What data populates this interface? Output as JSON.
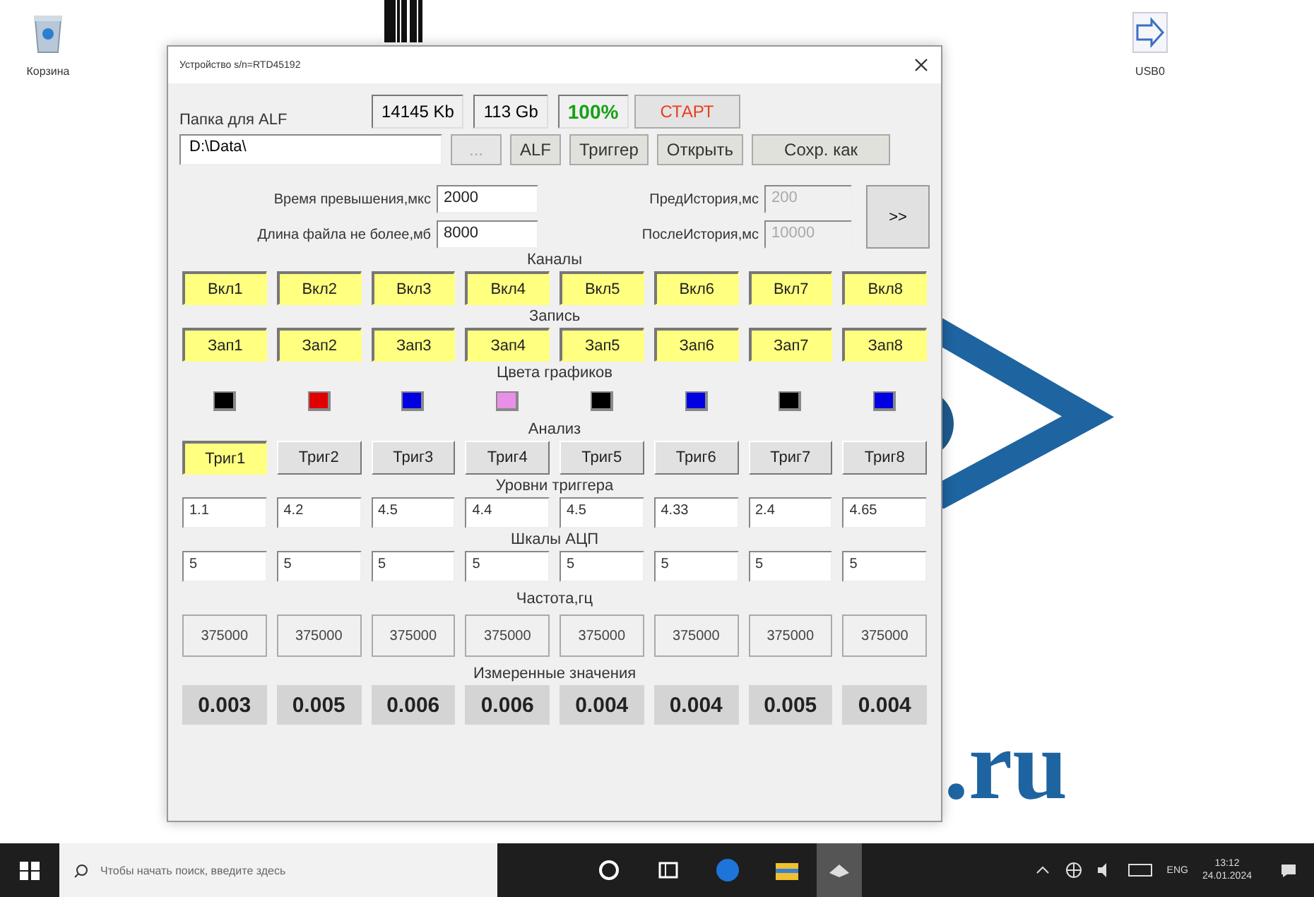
{
  "desktop": {
    "icons": [
      {
        "label": "Корзина",
        "kind": "recycle"
      },
      {
        "label": "USB0",
        "kind": "device"
      }
    ],
    "wallpaper_text": ".ru"
  },
  "window": {
    "title": "Устройство s/n=RTD45192",
    "stats": [
      {
        "text": "14145 Kb",
        "color": "#000000"
      },
      {
        "text": "113 Gb",
        "color": "#000000"
      },
      {
        "text": "100%",
        "color": "#16a016"
      }
    ],
    "start_button": "СТАРТ",
    "folder_label": "Папка для ALF",
    "folder_value": "D:\\Data\\",
    "buttons": [
      {
        "label": "...",
        "disabled": true
      },
      {
        "label": "ALF",
        "disabled": false
      },
      {
        "label": "Триггер",
        "disabled": false
      },
      {
        "label": "Открыть",
        "disabled": false
      },
      {
        "label": "Сохр. как",
        "disabled": false
      }
    ],
    "params": [
      {
        "label": "Время превышения,мкс",
        "value": "2000",
        "disabled": false
      },
      {
        "label": "ПредИстория,мс",
        "value": "200",
        "disabled": true
      },
      {
        "label": "Длина файла не более,мб",
        "value": "8000",
        "disabled": false
      },
      {
        "label": "ПослеИстория,мс",
        "value": "10000",
        "disabled": true
      }
    ],
    "more_button": ">>",
    "sections": [
      {
        "title": "Каналы",
        "kind": "toggles",
        "items": [
          {
            "label": "Вкл1",
            "checked": true
          },
          {
            "label": "Вкл2",
            "checked": true
          },
          {
            "label": "Вкл3",
            "checked": true
          },
          {
            "label": "Вкл4",
            "checked": true
          },
          {
            "label": "Вкл5",
            "checked": true
          },
          {
            "label": "Вкл6",
            "checked": true
          },
          {
            "label": "Вкл7",
            "checked": true
          },
          {
            "label": "Вкл8",
            "checked": true
          }
        ]
      },
      {
        "title": "Запись",
        "kind": "toggles",
        "items": [
          {
            "label": "Зап1",
            "checked": true
          },
          {
            "label": "Зап2",
            "checked": true
          },
          {
            "label": "Зап3",
            "checked": true
          },
          {
            "label": "Зап4",
            "checked": true
          },
          {
            "label": "Зап5",
            "checked": true
          },
          {
            "label": "Зап6",
            "checked": true
          },
          {
            "label": "Зап7",
            "checked": true
          },
          {
            "label": "Зап8",
            "checked": true
          }
        ]
      },
      {
        "title": "Цвета графиков",
        "kind": "colors",
        "items": [
          {
            "color": "#000000"
          },
          {
            "color": "#e00000"
          },
          {
            "color": "#0000e0"
          },
          {
            "color": "#e890e8"
          },
          {
            "color": "#000000"
          },
          {
            "color": "#0000e0"
          },
          {
            "color": "#000000"
          },
          {
            "color": "#0000e0"
          }
        ]
      },
      {
        "title": "Анализ",
        "kind": "toggles",
        "items": [
          {
            "label": "Триг1",
            "checked": true
          },
          {
            "label": "Триг2",
            "checked": false
          },
          {
            "label": "Триг3",
            "checked": false
          },
          {
            "label": "Триг4",
            "checked": false
          },
          {
            "label": "Триг5",
            "checked": false
          },
          {
            "label": "Триг6",
            "checked": false
          },
          {
            "label": "Триг7",
            "checked": false
          },
          {
            "label": "Триг8",
            "checked": false
          }
        ]
      },
      {
        "title": "Уровни триггера",
        "kind": "inputs",
        "items": [
          {
            "value": "1.1"
          },
          {
            "value": "4.2"
          },
          {
            "value": "4.5"
          },
          {
            "value": "4.4"
          },
          {
            "value": "4.5"
          },
          {
            "value": "4.33"
          },
          {
            "value": "2.4"
          },
          {
            "value": "4.65"
          }
        ]
      },
      {
        "title": "Шкалы АЦП",
        "kind": "inputs",
        "items": [
          {
            "value": "5"
          },
          {
            "value": "5"
          },
          {
            "value": "5"
          },
          {
            "value": "5"
          },
          {
            "value": "5"
          },
          {
            "value": "5"
          },
          {
            "value": "5"
          },
          {
            "value": "5"
          }
        ]
      },
      {
        "title": "Частота,гц",
        "kind": "cells",
        "items": [
          {
            "value": "375000"
          },
          {
            "value": "375000"
          },
          {
            "value": "375000"
          },
          {
            "value": "375000"
          },
          {
            "value": "375000"
          },
          {
            "value": "375000"
          },
          {
            "value": "375000"
          },
          {
            "value": "375000"
          }
        ]
      },
      {
        "title": "Измеренные значения",
        "kind": "readings",
        "items": [
          {
            "value": "0.003"
          },
          {
            "value": "0.005"
          },
          {
            "value": "0.006"
          },
          {
            "value": "0.006"
          },
          {
            "value": "0.004"
          },
          {
            "value": "0.004"
          },
          {
            "value": "0.005"
          },
          {
            "value": "0.004"
          }
        ]
      }
    ]
  },
  "taskbar": {
    "search_placeholder": "Чтобы начать поиск, введите здесь",
    "language": "ENG",
    "time": "13:12",
    "date": "24.01.2024"
  }
}
